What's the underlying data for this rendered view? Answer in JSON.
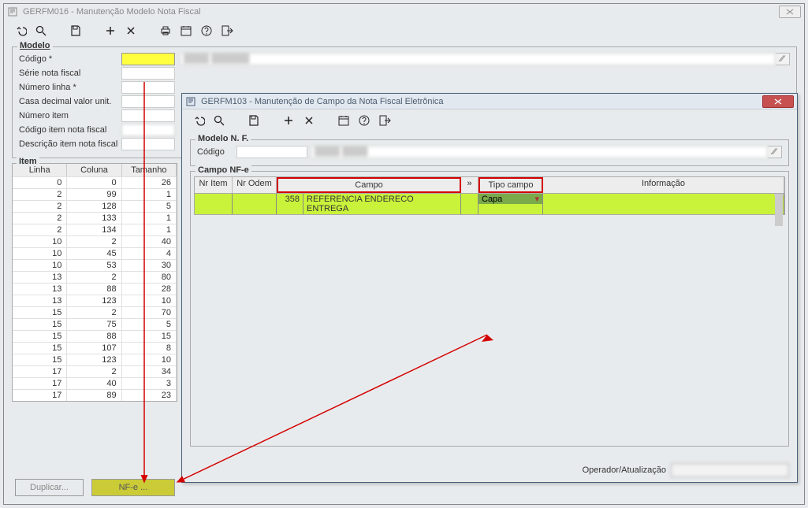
{
  "main_window": {
    "title": "GERFM016 - Manutenção Modelo Nota Fiscal",
    "toolbar_icons": [
      "undo",
      "search",
      "save",
      "add",
      "delete",
      "print",
      "calendar",
      "help",
      "exit"
    ]
  },
  "modelo": {
    "legend": "Modelo",
    "fields": {
      "codigo_label": "Código *",
      "serie_label": "Série nota fiscal",
      "numero_linha_label": "Número linha *",
      "casa_label": "Casa decimal valor unit.",
      "numero_item_label": "Número item",
      "codigo_item_label": "Código item nota fiscal",
      "descricao_item_label": "Descrição item nota fiscal"
    },
    "codigo_value": "",
    "readonly_value": ""
  },
  "item_grid": {
    "legend": "Item",
    "headers": [
      "Linha",
      "Coluna",
      "Tamanho"
    ],
    "rows": [
      {
        "linha": 0,
        "coluna": 0,
        "tamanho": 26
      },
      {
        "linha": 2,
        "coluna": 99,
        "tamanho": 1
      },
      {
        "linha": 2,
        "coluna": 128,
        "tamanho": 5
      },
      {
        "linha": 2,
        "coluna": 133,
        "tamanho": 1
      },
      {
        "linha": 2,
        "coluna": 134,
        "tamanho": 1
      },
      {
        "linha": 10,
        "coluna": 2,
        "tamanho": 40
      },
      {
        "linha": 10,
        "coluna": 45,
        "tamanho": 4
      },
      {
        "linha": 10,
        "coluna": 53,
        "tamanho": 30
      },
      {
        "linha": 13,
        "coluna": 2,
        "tamanho": 80
      },
      {
        "linha": 13,
        "coluna": 88,
        "tamanho": 28
      },
      {
        "linha": 13,
        "coluna": 123,
        "tamanho": 10
      },
      {
        "linha": 15,
        "coluna": 2,
        "tamanho": 70
      },
      {
        "linha": 15,
        "coluna": 75,
        "tamanho": 5
      },
      {
        "linha": 15,
        "coluna": 88,
        "tamanho": 15
      },
      {
        "linha": 15,
        "coluna": 107,
        "tamanho": 8
      },
      {
        "linha": 15,
        "coluna": 123,
        "tamanho": 10
      },
      {
        "linha": 17,
        "coluna": 2,
        "tamanho": 34
      },
      {
        "linha": 17,
        "coluna": 40,
        "tamanho": 3
      },
      {
        "linha": 17,
        "coluna": 89,
        "tamanho": 23
      }
    ]
  },
  "buttons": {
    "duplicar": "Duplicar...",
    "nfe": "NF-e ..."
  },
  "sub_window": {
    "title": "GERFM103 - Manutenção de Campo da Nota Fiscal Eletrônica",
    "modelo_nf": {
      "legend": "Modelo N. F.",
      "codigo_label": "Código",
      "codigo_value": "",
      "desc_value": ""
    },
    "campo_nfe": {
      "legend": "Campo NF-e",
      "headers": {
        "nr_item": "Nr Item",
        "nr_ordem": "Nr Odem",
        "campo": "Campo",
        "chev": "»",
        "tipo_campo": "Tipo campo",
        "informacao": "Informação"
      },
      "row": {
        "nr_item": "",
        "nr_ordem": "",
        "campo_id": "358",
        "campo_desc": "REFERENCIA ENDERECO ENTREGA",
        "tipo_campo": "Capa",
        "informacao": ""
      }
    },
    "status": {
      "label": "Operador/Atualização",
      "value": ""
    }
  },
  "chart_data": {
    "type": "table",
    "title": "Item",
    "columns": [
      "Linha",
      "Coluna",
      "Tamanho"
    ],
    "rows": [
      [
        0,
        0,
        26
      ],
      [
        2,
        99,
        1
      ],
      [
        2,
        128,
        5
      ],
      [
        2,
        133,
        1
      ],
      [
        2,
        134,
        1
      ],
      [
        10,
        2,
        40
      ],
      [
        10,
        45,
        4
      ],
      [
        10,
        53,
        30
      ],
      [
        13,
        2,
        80
      ],
      [
        13,
        88,
        28
      ],
      [
        13,
        123,
        10
      ],
      [
        15,
        2,
        70
      ],
      [
        15,
        75,
        5
      ],
      [
        15,
        88,
        15
      ],
      [
        15,
        107,
        8
      ],
      [
        15,
        123,
        10
      ],
      [
        17,
        2,
        34
      ],
      [
        17,
        40,
        3
      ],
      [
        17,
        89,
        23
      ]
    ]
  }
}
